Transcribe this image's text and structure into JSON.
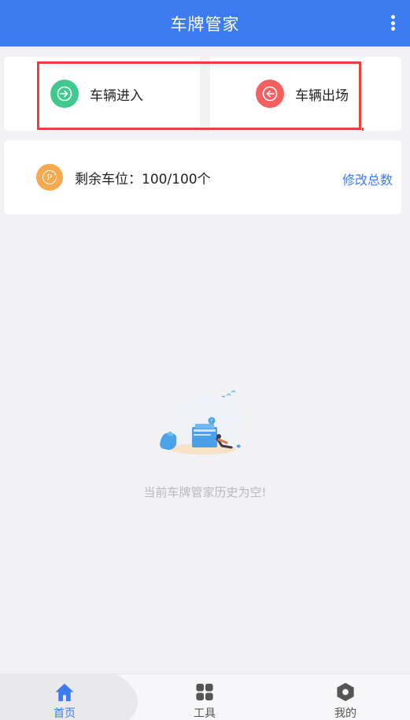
{
  "appbar": {
    "title": "车牌管家",
    "menu_icon": "more-vertical-icon"
  },
  "actions": {
    "enter": {
      "label": "车辆进入",
      "icon": "enter-arrow-icon",
      "color": "#3fc98e"
    },
    "exit": {
      "label": "车辆出场",
      "icon": "exit-arrow-icon",
      "color": "#f4605f"
    }
  },
  "parking": {
    "icon": "parking-icon",
    "icon_letter": "P",
    "remaining_text": "剩余车位：100/100个",
    "modify_label": "修改总数",
    "accent": "#3d7bf0"
  },
  "empty_state": {
    "message": "当前车牌管家历史为空!"
  },
  "bottom_nav": {
    "items": [
      {
        "label": "首页",
        "icon": "home-icon",
        "active": true
      },
      {
        "label": "工具",
        "icon": "grid-icon",
        "active": false
      },
      {
        "label": "我的",
        "icon": "hexagon-icon",
        "active": false
      }
    ]
  },
  "colors": {
    "primary": "#3d7bf0",
    "highlight": "#e8403f",
    "parking": "#f8a94e"
  }
}
